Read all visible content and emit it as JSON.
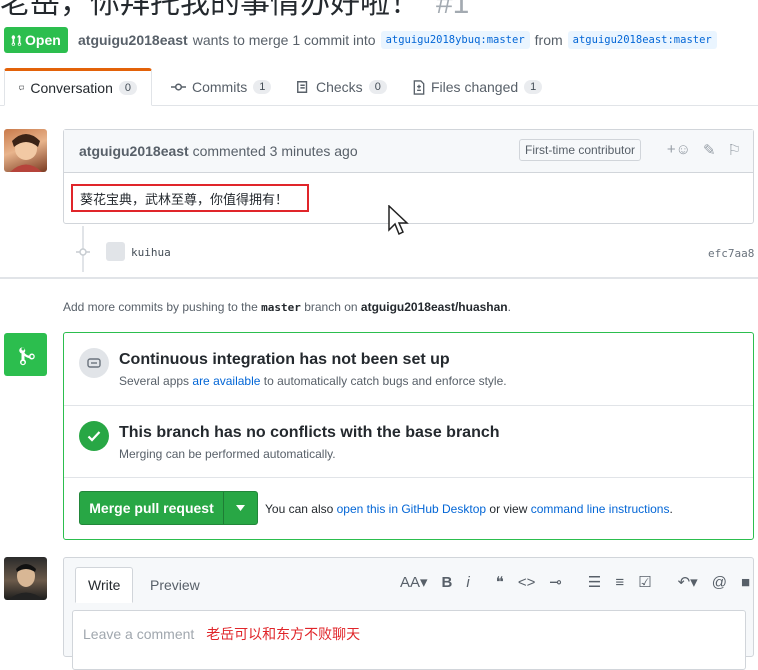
{
  "pr": {
    "title": "老岳，你拜托我的事情办好啦！",
    "number": "#1",
    "state": "Open",
    "author": "atguigu2018east",
    "merge_text": "wants to merge 1 commit into",
    "base_ref": "atguigu2018ybuq:master",
    "from_text": "from",
    "head_ref": "atguigu2018east:master"
  },
  "tabs": [
    {
      "label": "Conversation",
      "count": "0"
    },
    {
      "label": "Commits",
      "count": "1"
    },
    {
      "label": "Checks",
      "count": "0"
    },
    {
      "label": "Files changed",
      "count": "1"
    }
  ],
  "comment": {
    "author": "atguigu2018east",
    "action": "commented",
    "time": "3 minutes ago",
    "badge": "First-time contributor",
    "body": "葵花宝典，武林至尊，你值得拥有！"
  },
  "commit": {
    "message": "kuihua",
    "sha": "efc7aa8"
  },
  "push_note": {
    "prefix": "Add more commits by pushing to the",
    "branch": "master",
    "middle": "branch on",
    "repo": "atguigu2018east/huashan",
    "suffix": "."
  },
  "ci": {
    "title": "Continuous integration has not been set up",
    "sub_prefix": "Several apps",
    "sub_link": "are available",
    "sub_suffix": "to automatically catch bugs and enforce style."
  },
  "conflicts": {
    "title": "This branch has no conflicts with the base branch",
    "sub": "Merging can be performed automatically."
  },
  "merge": {
    "button": "Merge pull request",
    "alt_prefix": "You can also",
    "alt_link1": "open this in GitHub Desktop",
    "alt_middle": "or view",
    "alt_link2": "command line instructions",
    "alt_suffix": "."
  },
  "editor": {
    "tab_write": "Write",
    "tab_preview": "Preview",
    "placeholder": "Leave a comment",
    "typed": "老岳可以和东方不败聊天"
  },
  "colors": {
    "open_green": "#2cbe4e",
    "merge_button": "#28a745",
    "highlight_red": "#e0252a",
    "link_blue": "#0366d6"
  }
}
